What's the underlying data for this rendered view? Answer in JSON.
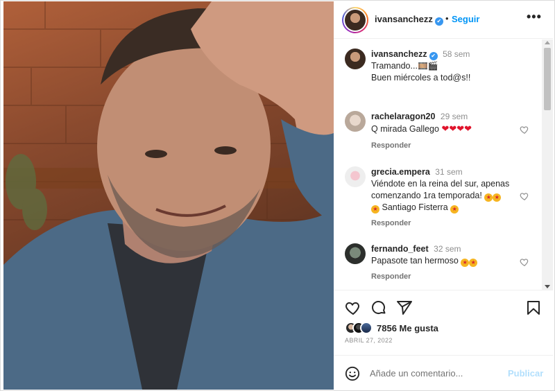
{
  "post": {
    "username": "ivansanchezz",
    "follow_label": "Seguir",
    "dot": "•",
    "more_label": "•••",
    "verified_mark": "✔"
  },
  "caption": {
    "username": "ivansanchezz",
    "time": "58 sem",
    "line1": "Tramando...",
    "line1_emojis": "🎞️🎬",
    "line2": "Buen miércoles a tod@s!!"
  },
  "comments": [
    {
      "username": "rachelaragon20",
      "time": "29 sem",
      "text": "Q mirada Gallego",
      "emojis": "❤❤❤❤",
      "reply_label": "Responder"
    },
    {
      "username": "grecia.empera",
      "time": "31 sem",
      "text": "Viéndote en la reina del sur, apenas comenzando 1ra temporada!",
      "text2": "Santiago Fisterra",
      "reply_label": "Responder"
    },
    {
      "username": "fernando_feet",
      "time": "32 sem",
      "text": "Papasote tan hermoso",
      "reply_label": "Responder"
    }
  ],
  "likes": {
    "count_label": "7856 Me gusta"
  },
  "date": "ABRIL 27, 2022",
  "composer": {
    "placeholder": "Añade un comentario...",
    "post_label": "Publicar"
  },
  "icons": {
    "like": "heart-icon",
    "comment": "comment-icon",
    "share": "share-icon",
    "save": "bookmark-icon",
    "emoji": "emoji-icon",
    "more": "more-options-icon"
  },
  "colors": {
    "link_blue": "#0095f6",
    "post_disabled": "#b2dffc",
    "heart_red": "#e0142c",
    "muted": "#8e8e8e"
  }
}
